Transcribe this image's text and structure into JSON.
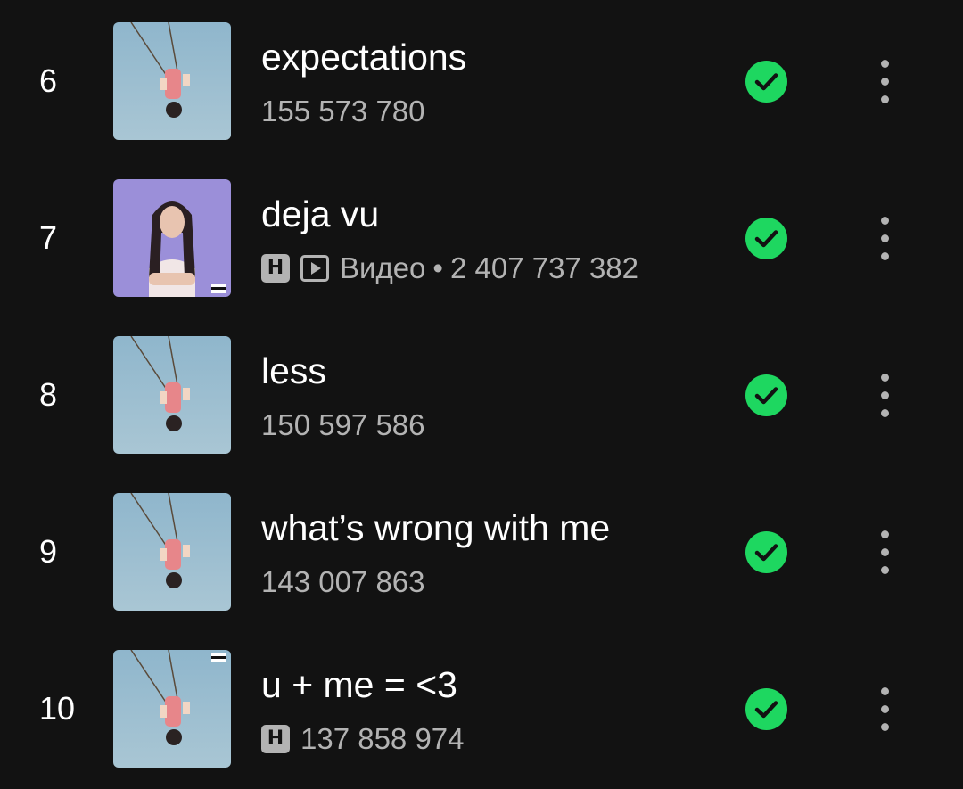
{
  "tracks": [
    {
      "rank": "6",
      "title": "expectations",
      "plays": "155 573 780",
      "explicit": false,
      "video": false,
      "video_label": "",
      "downloaded": true
    },
    {
      "rank": "7",
      "title": "deja vu",
      "plays": "2 407 737 382",
      "explicit": true,
      "video": true,
      "video_label": "Видео",
      "downloaded": true
    },
    {
      "rank": "8",
      "title": "less",
      "plays": "150 597 586",
      "explicit": false,
      "video": false,
      "video_label": "",
      "downloaded": true
    },
    {
      "rank": "9",
      "title": "what’s wrong with me",
      "plays": "143 007 863",
      "explicit": false,
      "video": false,
      "video_label": "",
      "downloaded": true
    },
    {
      "rank": "10",
      "title": "u + me = <3",
      "plays": "137 858 974",
      "explicit": true,
      "video": false,
      "video_label": "",
      "downloaded": true
    }
  ],
  "badges": {
    "explicit_letter": "Н",
    "separator": "•"
  },
  "colors": {
    "background": "#121212",
    "primary_text": "#ffffff",
    "secondary_text": "#b3b3b3",
    "downloaded_green": "#1ed760"
  },
  "icons": {
    "downloaded": "check-circle-icon",
    "more": "more-vertical-icon",
    "video": "video-play-icon"
  }
}
